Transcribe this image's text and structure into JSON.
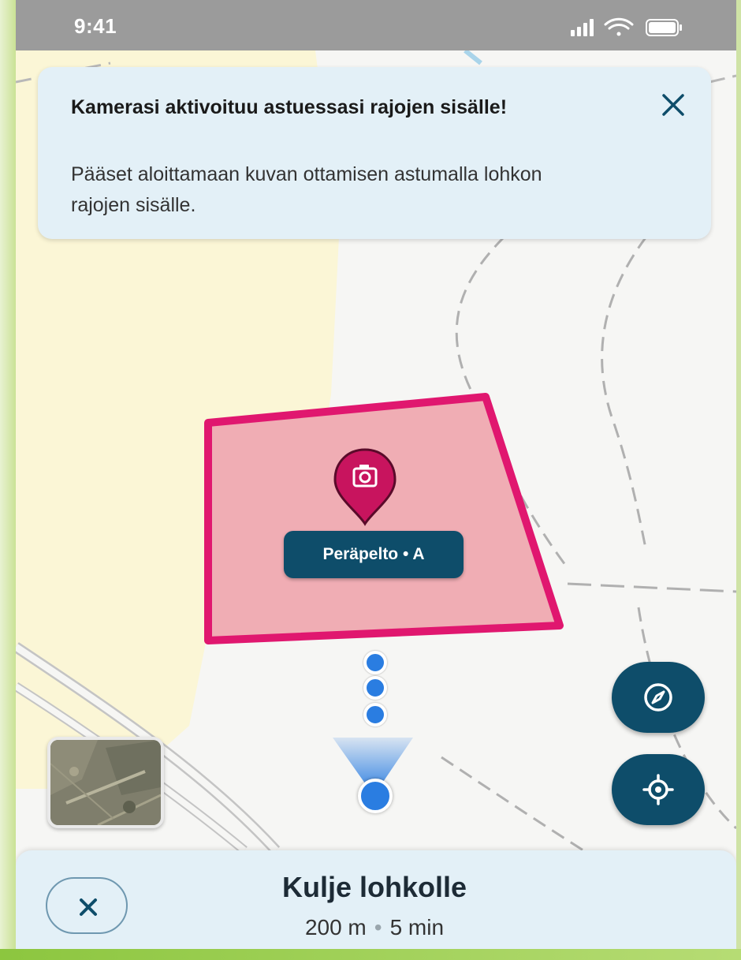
{
  "status_bar": {
    "time": "9:41",
    "icons": [
      "cellular-signal-icon",
      "wifi-icon",
      "battery-icon"
    ]
  },
  "toast": {
    "title": "Kamerasi aktivoituu astuessasi rajojen sisälle!",
    "body": "Pääset aloittamaan kuvan ottamisen astumalla lohkon rajojen sisälle.",
    "close_icon": "close-icon"
  },
  "map": {
    "field_label": "Peräpelto • A",
    "pin_icon": "camera-icon",
    "field_color": "#e0176f",
    "field_fill": "#f0adb4"
  },
  "controls": {
    "compass_icon": "compass-icon",
    "locate_icon": "locate-icon",
    "layer_thumbnail": "satellite-layer-thumbnail"
  },
  "sheet": {
    "title": "Kulje lohkolle",
    "distance": "200 m",
    "separator": "•",
    "duration": "5 min",
    "cancel_icon": "close-icon"
  },
  "colors": {
    "accent": "#0e4d6a",
    "location_blue": "#2a7de1",
    "banner_bg": "#e3f0f7"
  }
}
